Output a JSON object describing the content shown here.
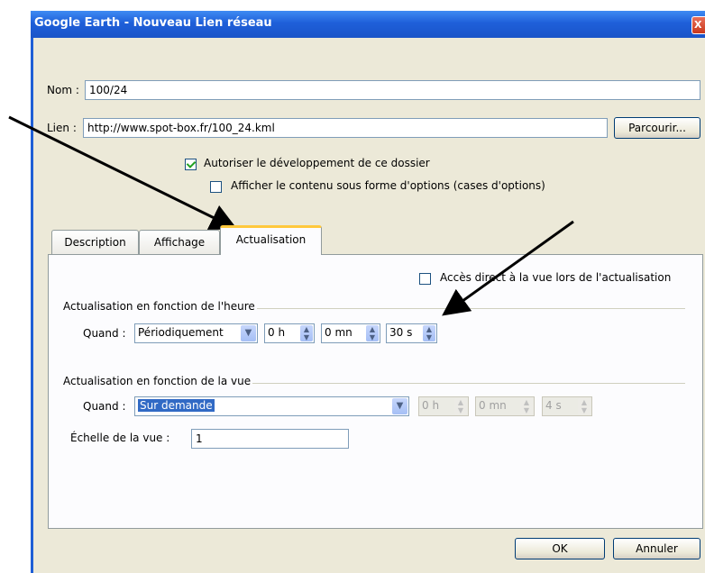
{
  "window": {
    "title": "Google Earth - Nouveau Lien réseau",
    "close_glyph": "X"
  },
  "form": {
    "name_label": "Nom :",
    "name_value": "100/24",
    "link_label": "Lien :",
    "link_value": "http://www.spot-box.fr/100_24.kml",
    "browse_label": "Parcourir...",
    "allow_expand_label": "Autoriser le développement de ce dossier",
    "allow_expand_checked": true,
    "show_as_options_label": "Afficher le contenu sous forme d'options (cases d'options)",
    "show_as_options_checked": false
  },
  "tabs": [
    {
      "label": "Description",
      "active": false
    },
    {
      "label": "Affichage",
      "active": false
    },
    {
      "label": "Actualisation",
      "active": true
    }
  ],
  "refresh": {
    "direct_access_label": "Accès direct à la vue lors de l'actualisation",
    "direct_access_checked": false,
    "time_group_label": "Actualisation en fonction de l'heure",
    "time_when_label": "Quand :",
    "time_when_value": "Périodiquement",
    "time_hours": "0 h",
    "time_minutes": "0 mn",
    "time_seconds": "30 s",
    "view_group_label": "Actualisation en fonction de la vue",
    "view_when_label": "Quand :",
    "view_when_value": "Sur demande",
    "view_hours": "0 h",
    "view_minutes": "0 mn",
    "view_seconds": "4 s",
    "scale_label": "Échelle de la vue :",
    "scale_value": "1"
  },
  "buttons": {
    "ok": "OK",
    "cancel": "Annuler"
  },
  "icons": {
    "dropdown": "chevron-down-icon",
    "spinner": "up-down-arrows-icon",
    "annotation": "arrow-annotation"
  }
}
